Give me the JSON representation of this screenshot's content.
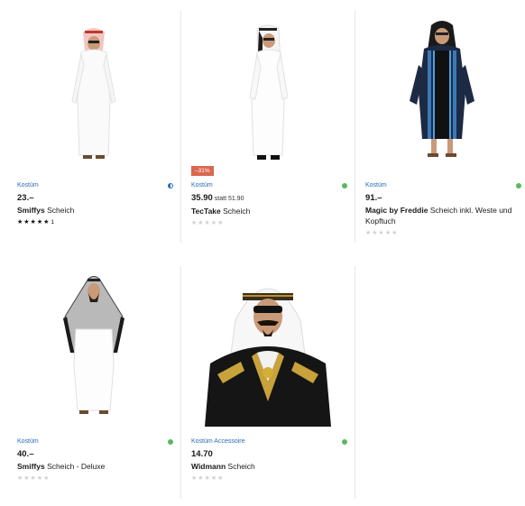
{
  "products": [
    {
      "category": "Kostüm",
      "price": "23.–",
      "was": "",
      "brand": "Smiffys",
      "name": "Scheich",
      "rating_count": "1",
      "badge": "",
      "availability": "half"
    },
    {
      "category": "Kostüm",
      "price": "35.90",
      "was": "statt 51.90",
      "brand": "TecTake",
      "name": "Scheich",
      "rating_count": "",
      "badge": "–31%",
      "availability": "available"
    },
    {
      "category": "Kostüm",
      "price": "91.–",
      "was": "",
      "brand": "Magic by Freddie",
      "name": "Scheich inkl. Weste und Kopftuch",
      "rating_count": "",
      "badge": "",
      "availability": "available"
    },
    {
      "category": "Kostüm",
      "price": "40.–",
      "was": "",
      "brand": "Smiffys",
      "name": "Scheich - Deluxe",
      "rating_count": "",
      "badge": "",
      "availability": "available"
    },
    {
      "category": "Kostüm Accessoire",
      "price": "14.70",
      "was": "",
      "brand": "Widmann",
      "name": "Scheich",
      "rating_count": "",
      "badge": "",
      "availability": "available"
    }
  ],
  "stars": {
    "filled": "★★★★★",
    "empty": "★★★★★"
  },
  "colors": {
    "link": "#2a6ab5",
    "available": "#5cb85c",
    "badge": "#d9674e"
  }
}
